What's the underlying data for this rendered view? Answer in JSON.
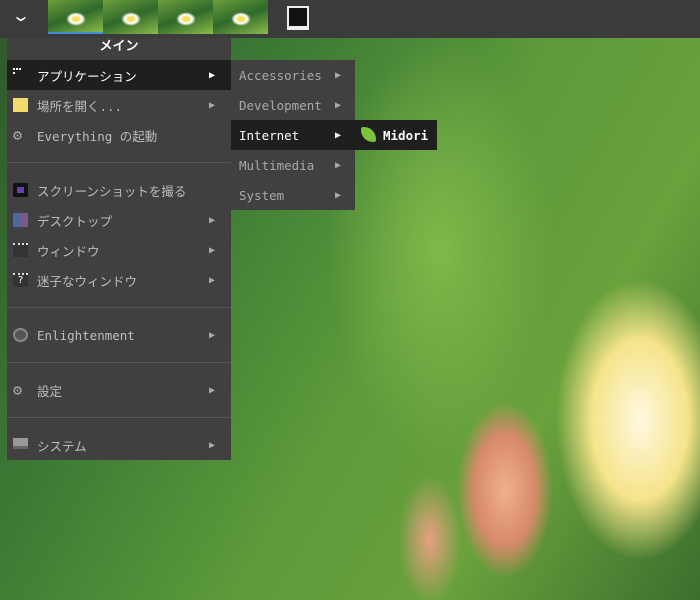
{
  "topbar": {
    "start_icon": "chevron-down-icon",
    "desktops": 4,
    "active_desktop": 1,
    "app_icon": "terminal-icon"
  },
  "main_menu": {
    "title": "メイン",
    "items": [
      {
        "label": "アプリケーション",
        "icon": "applications-icon"
      },
      {
        "label": "場所を開く...",
        "icon": "folder-icon"
      },
      {
        "label": "Everything の起動",
        "icon": "gear-icon"
      },
      {
        "label": "スクリーンショットを撮る",
        "icon": "camera-icon"
      },
      {
        "label": "デスクトップ",
        "icon": "desktop-icon"
      },
      {
        "label": "ウィンドウ",
        "icon": "window-icon"
      },
      {
        "label": "迷子なウィンドウ",
        "icon": "lost-window-icon"
      },
      {
        "label": "Enlightenment",
        "icon": "enlightenment-icon"
      },
      {
        "label": "設定",
        "icon": "settings-icon"
      },
      {
        "label": "システム",
        "icon": "monitor-icon"
      }
    ]
  },
  "applications_menu": {
    "items": [
      "Accessories",
      "Development",
      "Internet",
      "Multimedia",
      "System"
    ]
  },
  "internet_menu": {
    "items": [
      {
        "label": "Midori",
        "icon": "midori-leaf-icon"
      }
    ]
  }
}
